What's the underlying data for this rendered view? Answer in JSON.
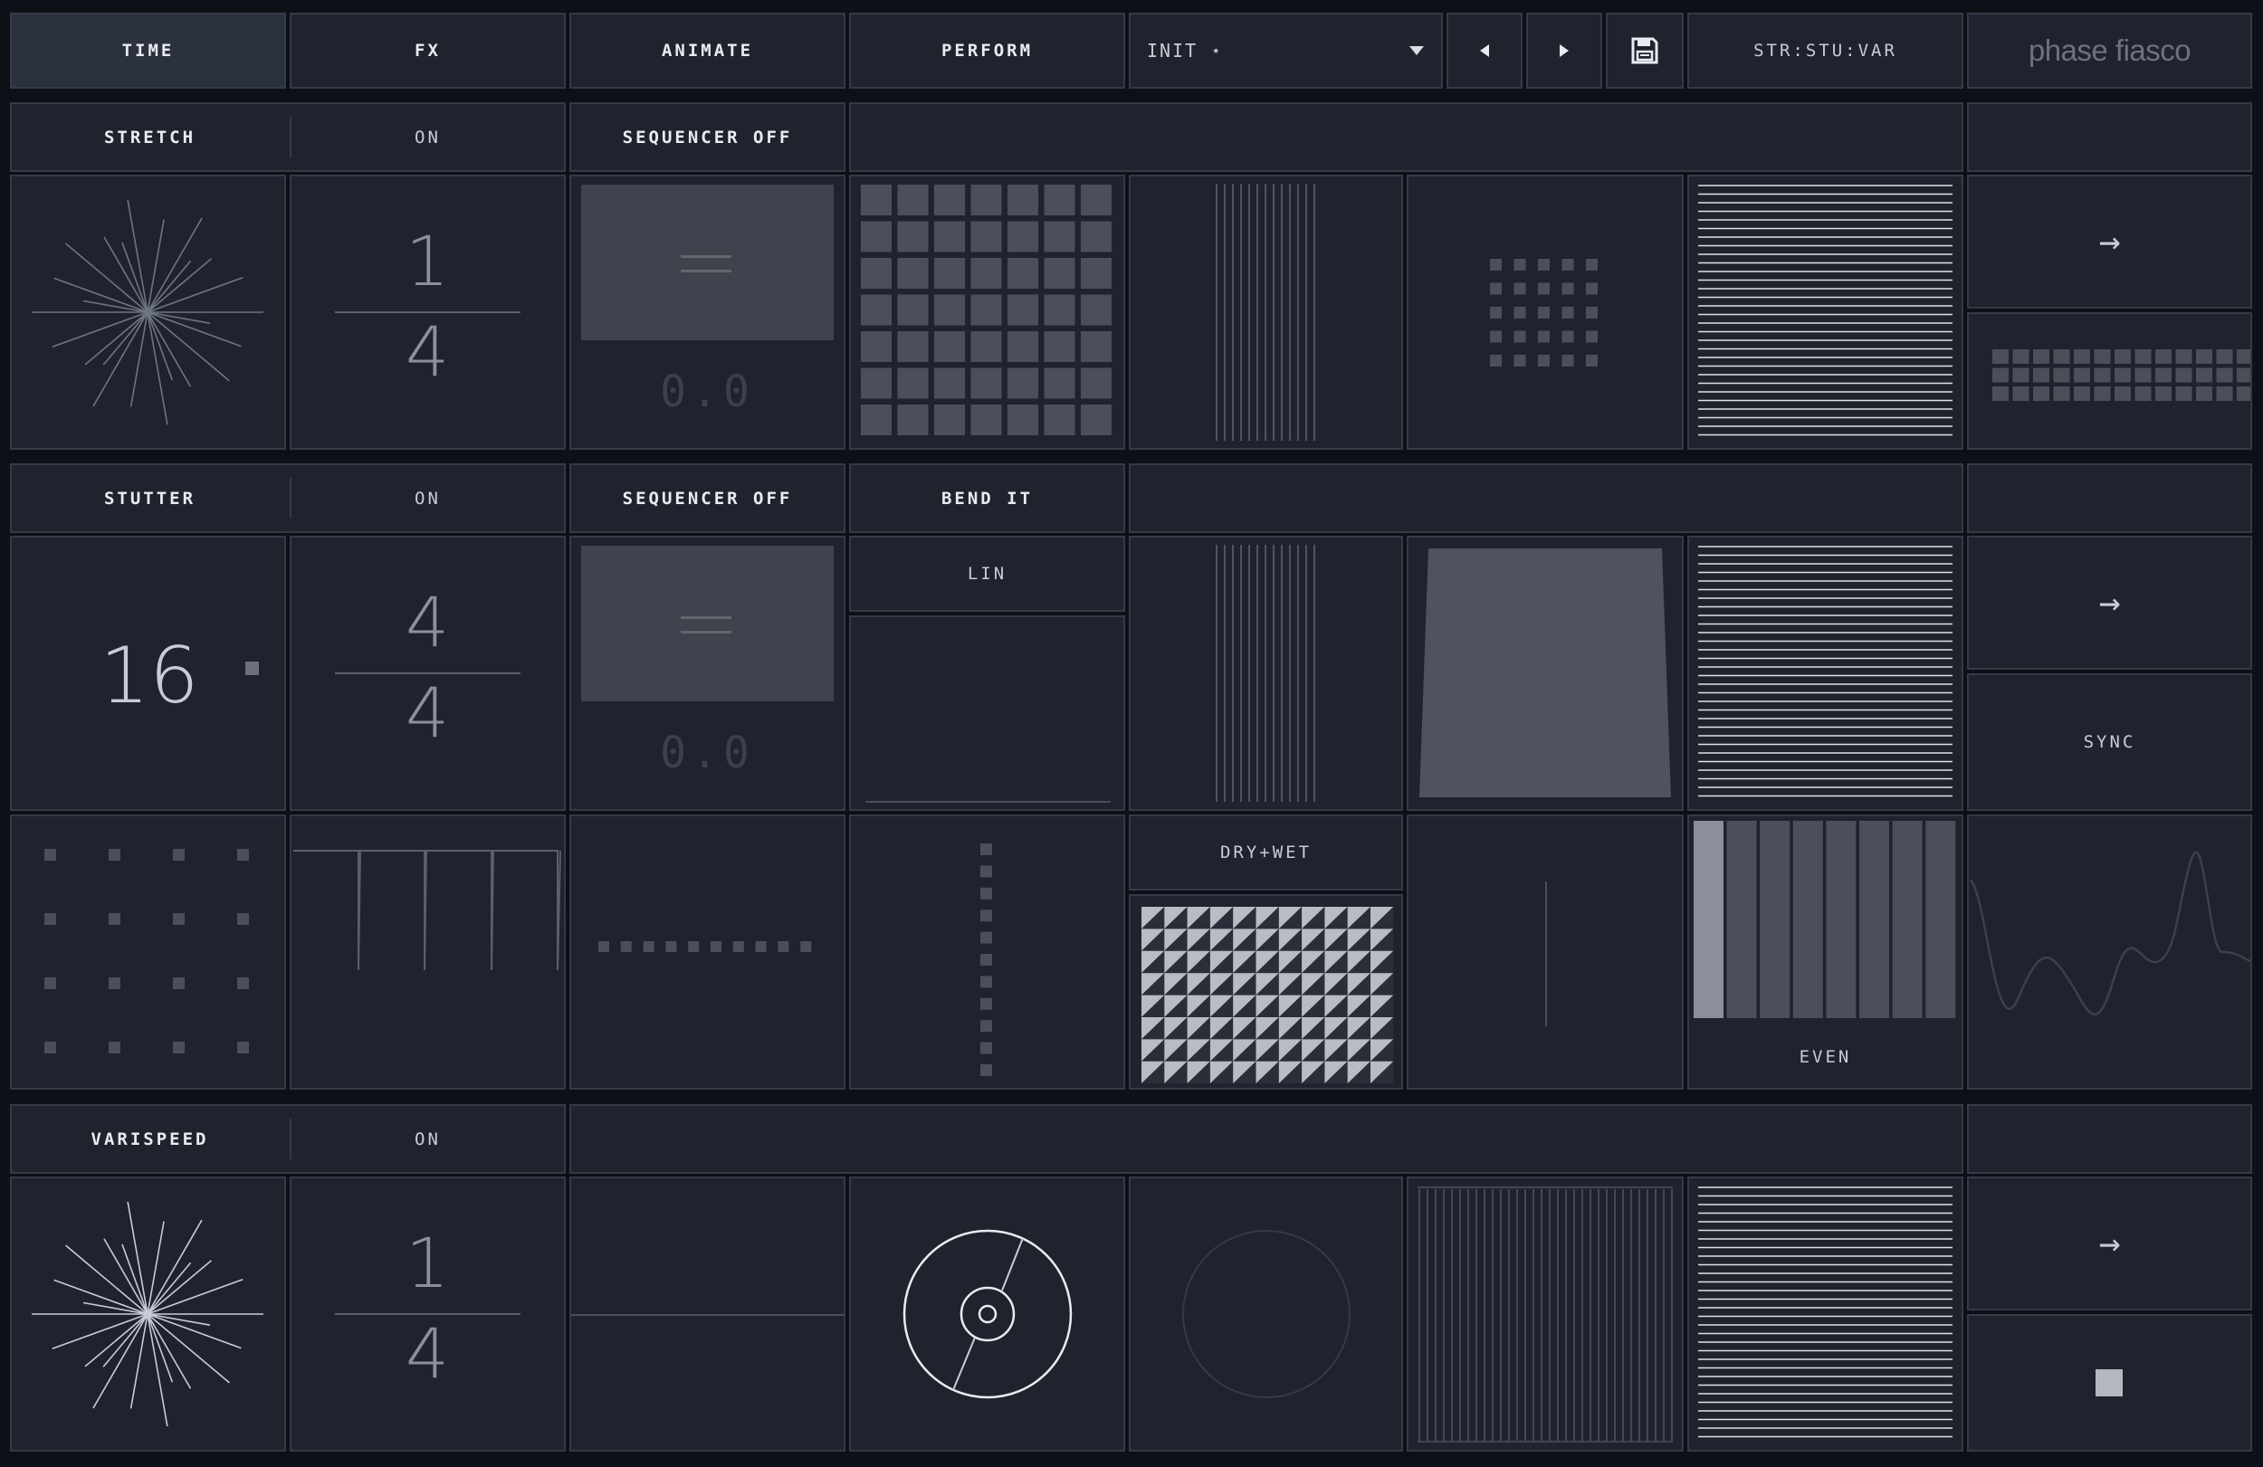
{
  "nav": {
    "tabs": [
      "TIME",
      "FX",
      "ANIMATE",
      "PERFORM"
    ],
    "active_tab": "TIME",
    "preset": "INIT ⋆",
    "prev_icon": "triangle-left-icon",
    "next_icon": "triangle-right-icon",
    "save_icon": "floppy-disk-icon",
    "mode": "STR:STU:VAR",
    "logo": "phase fiasco"
  },
  "stretch": {
    "label": "STRETCH",
    "toggle": "ON",
    "sequencer": "SEQUENCER OFF",
    "fraction_num": "1",
    "fraction_den": "4",
    "seq_value": "0.0",
    "arrow": "→"
  },
  "stutter": {
    "label": "STUTTER",
    "toggle": "ON",
    "sequencer": "SEQUENCER OFF",
    "bend": "BEND IT",
    "curve": "LIN",
    "count": "16",
    "fraction_num": "4",
    "fraction_den": "4",
    "seq_value": "0.0",
    "mix": "DRY+WET",
    "even": "EVEN",
    "sync": "SYNC",
    "arrow": "→"
  },
  "varispeed": {
    "label": "VARISPEED",
    "toggle": "ON",
    "fraction_num": "1",
    "fraction_den": "4",
    "arrow": "→",
    "stop_icon": "stop-square-icon"
  },
  "colors": {
    "background": "#0d1017",
    "cell": "#1f232e",
    "border": "#343a47",
    "accent_gray": "#8b909b"
  }
}
